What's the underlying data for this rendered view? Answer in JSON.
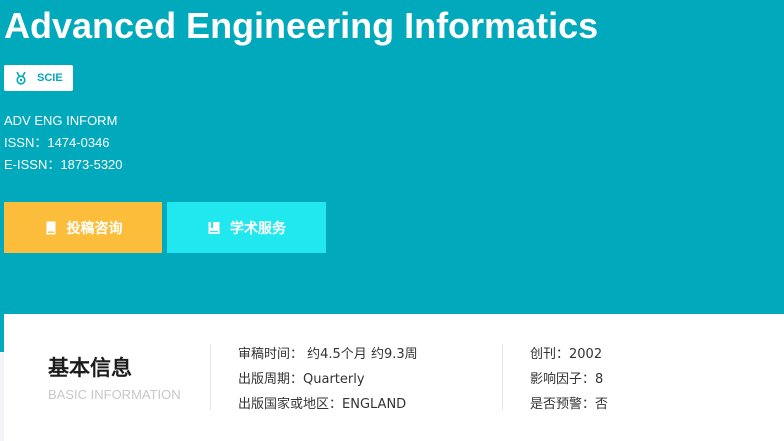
{
  "journal": {
    "title": "Advanced Engineering Informatics",
    "badge": "SCIE",
    "abbreviation": "ADV ENG INFORM",
    "issn": "ISSN：1474-0346",
    "eissn": "E-ISSN：1873-5320"
  },
  "buttons": {
    "submit_consult": "投稿咨询",
    "academic_service": "学术服务"
  },
  "basic_info": {
    "title": "基本信息",
    "subtitle": "BASIC INFORMATION",
    "column1": [
      "审稿时间： 约4.5个月 约9.3周",
      "出版周期：Quarterly",
      "出版国家或地区：ENGLAND"
    ],
    "column2": [
      "创刊：2002",
      "影响因子：8",
      "是否预警：否"
    ]
  },
  "colors": {
    "hero_bg": "#00a9bb",
    "submit_button": "#fbbd3a",
    "service_button": "#21e8ee",
    "card_bg": "#ffffff"
  },
  "icons": {
    "badge": "medal-icon",
    "submit": "document-icon",
    "service": "book-icon"
  }
}
